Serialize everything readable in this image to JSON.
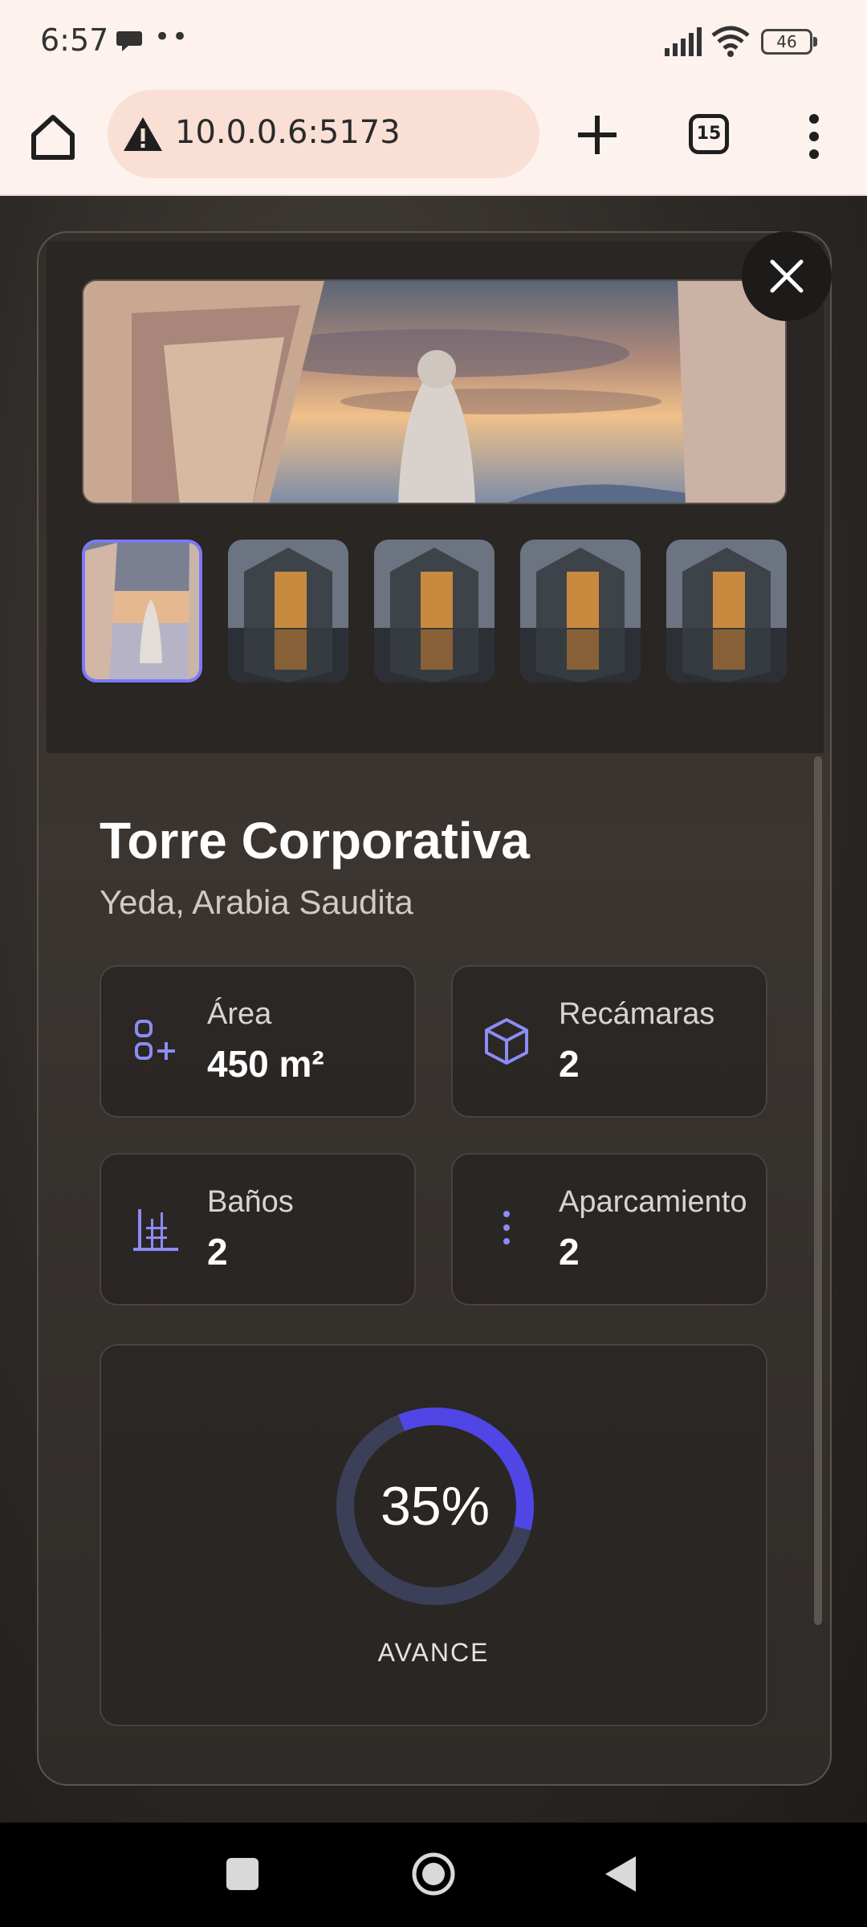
{
  "status_bar": {
    "time": "6:57",
    "dots": "••",
    "battery": "46"
  },
  "browser": {
    "url": "10.0.0.6:5173",
    "tab_count": "15"
  },
  "property": {
    "title": "Torre Corporativa",
    "location": "Yeda, Arabia Saudita",
    "stats": [
      {
        "label": "Área",
        "value": "450 m²",
        "icon": "area-icon"
      },
      {
        "label": "Recámaras",
        "value": "2",
        "icon": "cube-icon"
      },
      {
        "label": "Baños",
        "value": "2",
        "icon": "bath-icon"
      },
      {
        "label": "Aparcamiento",
        "value": "2",
        "icon": "dots-vertical-icon"
      }
    ],
    "progress": {
      "percent_text": "35%",
      "percent": 35,
      "label": "AVANCE"
    }
  },
  "colors": {
    "accent": "#4f46e5",
    "ring_track": "#3b4058",
    "icon": "#8b8cf5"
  }
}
